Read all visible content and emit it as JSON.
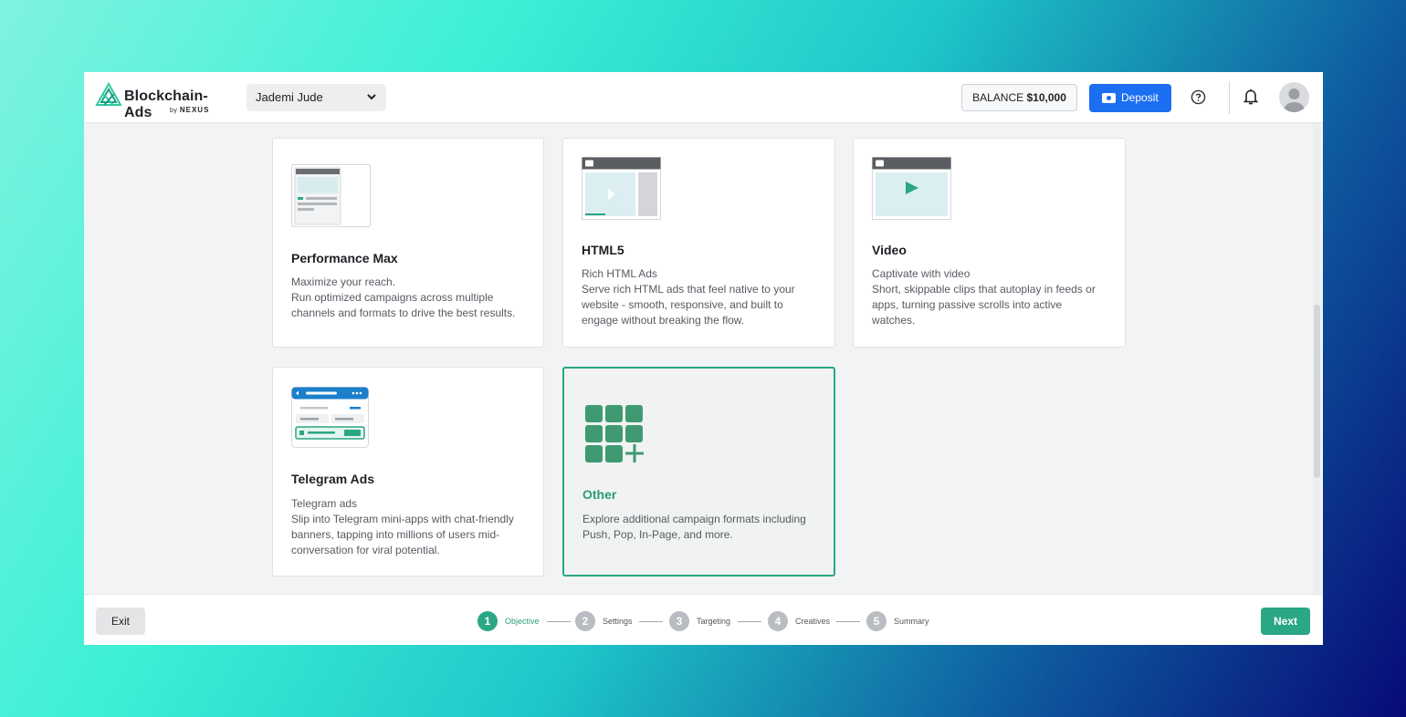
{
  "brand": {
    "name": "Blockchain-Ads",
    "by": "by",
    "partner": "NEXUS"
  },
  "account": {
    "selected": "Jademi Jude"
  },
  "balance": {
    "label": "BALANCE",
    "amount": "$10,000"
  },
  "deposit": {
    "label": "Deposit"
  },
  "icons": [
    "help-icon",
    "bell-icon",
    "avatar-icon",
    "chevron-down-icon",
    "cash-icon"
  ],
  "colors": {
    "accent": "#2aa784",
    "primary": "#1d6ff2"
  },
  "formats": [
    {
      "title": "Performance Max",
      "lines": [
        "Maximize your reach.",
        "Run optimized campaigns across multiple",
        "channels and formats to drive the best results."
      ]
    },
    {
      "title": "HTML5",
      "lines": [
        "Rich HTML Ads",
        "Serve rich HTML ads that feel native to your",
        "website - smooth, responsive, and built to",
        "engage without breaking the flow."
      ]
    },
    {
      "title": "Video",
      "lines": [
        "Captivate with video",
        "Short, skippable clips that autoplay in feeds or",
        "apps, turning passive scrolls into active",
        "watches."
      ]
    },
    {
      "title": "Telegram Ads",
      "lines": [
        "Telegram ads",
        "Slip into Telegram mini-apps with chat-friendly",
        "banners, tapping into millions of users mid-",
        "conversation for viral potential."
      ]
    },
    {
      "title": "Other",
      "selected": true,
      "lines": [
        "Explore additional campaign formats including",
        "Push, Pop, In-Page, and more."
      ]
    }
  ],
  "footer": {
    "exit_label": "Exit",
    "next_label": "Next",
    "steps": [
      {
        "num": "1",
        "label": "Objective",
        "active": true
      },
      {
        "num": "2",
        "label": "Settings"
      },
      {
        "num": "3",
        "label": "Targeting"
      },
      {
        "num": "4",
        "label": "Creatives"
      },
      {
        "num": "5",
        "label": "Summary"
      }
    ]
  }
}
